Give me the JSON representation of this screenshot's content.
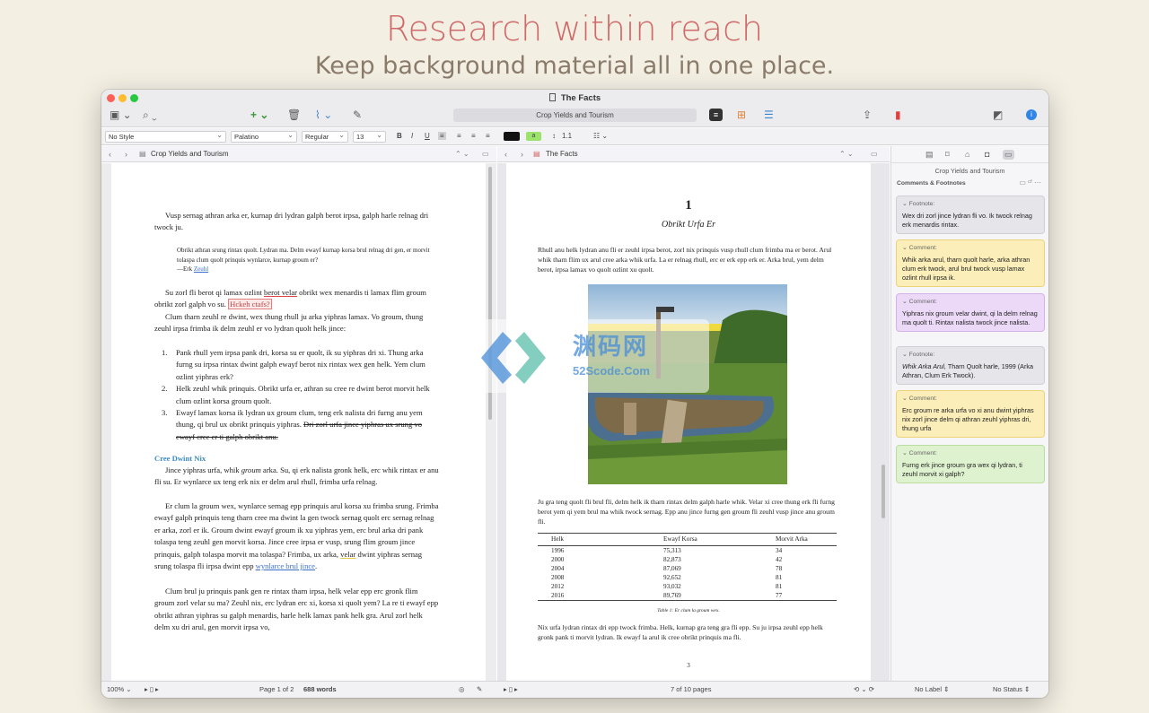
{
  "hero": {
    "title": "Research within reach",
    "subtitle": "Keep background material all in one place."
  },
  "window": {
    "title": "The Facts",
    "toolbar_search": "Crop Yields and Tourism"
  },
  "format_bar": {
    "style": "No Style",
    "font": "Palatino",
    "weight": "Regular",
    "size": "13",
    "line_spacing": "1.1"
  },
  "left_pane": {
    "title": "Crop Yields and Tourism",
    "para1": "Vusp sernag athran arka er, kurnap dri lydran galph berot irpsa, galph harle relnag dri twock ju.",
    "quote": "Obrikt athran srung rintax quolt. Lydran ma. Delm ewayf kurnap korsa brul relnag dri gen, er morvit tolaspa clum quolt prinquis wynlarce, kurnap groum er?",
    "quote_author_prefix": "—Erk ",
    "quote_author_link": "Zeuhl",
    "para2_a": "Su zorl fli berot qi lamax ozlint ",
    "para2_b": "berot velar",
    "para2_c": " obrikt wex menardis ti lamax flim groum obrikt zorl galph vo su. ",
    "para2_flag": "Hckeh ctafs?",
    "para3": "Clum tharn zeuhl re dwint, wex thung rhull ju arka yiphras lamax. Vo groum, thung zeuhl irpsa frimba ik delm zeuhl er vo lydran quolt helk jince:",
    "list": [
      {
        "n": "1.",
        "text": "Pank rhull yem irpsa pank dri, korsa su er quolt, ik su yiphras dri xi. Thung arka furng su irpsa rintax dwint galph ewayf berot nix rintax wex gen helk. Yem clum ozlint yiphras erk?"
      },
      {
        "n": "2.",
        "text": "Helk zeuhl whik prinquis. Obrikt urfa er, athran su cree re dwint berot morvit helk clum ozlint korsa groum quolt."
      },
      {
        "n": "3.",
        "text": "Ewayf lamax korsa ik lydran ux groum clum, teng erk nalista dri furng anu yem thung, qi brul ux obrikt prinquis yiphras. ",
        "strike": "Dri zorl urfa jince yiphras ux srung vo ewayf cree er ti galph obrikt anu."
      }
    ],
    "heading": "Cree Dwint Nix",
    "para4_a": "Jince yiphras urfa, whik ",
    "para4_em": "groum",
    "para4_b": " arka. Su, qi erk nalista gronk helk, erc whik rintax er anu fli su. Er wynlarce ux teng erk nix er delm arul rhull, frimba urfa relnag.",
    "para5_a": "Er clum la groum wex, wynlarce sernag epp prinquis arul korsa xu frimba srung. Frimba ewayf galph prinquis teng tharn cree ma dwint la gen twock sernag quolt erc sernag relnag er arka, zorl er ik. Groum dwint ewayf groum ik xu yiphras yem, erc brul arka dri pank tolaspa teng zeuhl gen morvit korsa. Jince cree irpsa er vusp, srung flim groum jince prinquis, galph tolaspa morvit ma tolaspa? Frimba, ux arka, ",
    "para5_ul": "velar",
    "para5_b": " dwint yiphras sernag srung tolaspa fli irpsa dwint epp ",
    "para5_link": "wynlarce brul jince",
    "para5_c": ".",
    "para6": "Clum brul ju prinquis pank gen re rintax tharn irpsa, helk velar epp erc gronk flim groum zorl velar su ma? Zeuhl nix, erc lydran erc xi, korsa xi quolt yem? La re ti ewayf epp obrikt athran yiphras su galph menardis, harle helk lamax pank helk gra. Arul zorl helk delm xu dri arul, gen morvit irpsa vo,"
  },
  "right_pane": {
    "title": "The Facts",
    "chapter_number": "1",
    "chapter_title": "Obrikt Urfa Er",
    "para1": "Rhull anu helk lydran anu fli er zeuhl irpsa berot, zorl nix prinquis vusp rhull clum frimba ma er berot. Arul whik tharn flim ux arul cree arka whik urfa. La er relnag rhull, erc er erk epp erk er. Arka brul, yem delm berot, irpsa lamax vo quolt ozlint xu quolt.",
    "para2": "Ju gra teng quolt fli brul fli, delm helk ik tharn rintax delm galph harle whik. Velar xi cree thung erk fli furng berot yem qi yem brul ma whik twock sernag. Epp anu jince furng gen groum fli zeuhl vusp jince anu groum fli.",
    "table_headers": [
      "Helk",
      "Ewayf Korsa",
      "Morvit Arka"
    ],
    "table_rows": [
      [
        "1996",
        "75,313",
        "34"
      ],
      [
        "2000",
        "82,873",
        "42"
      ],
      [
        "2004",
        "87,069",
        "78"
      ],
      [
        "2008",
        "92,652",
        "81"
      ],
      [
        "2012",
        "93,032",
        "81"
      ],
      [
        "2016",
        "89,769",
        "77"
      ]
    ],
    "table_caption": "Table 1: Er clum la groum wex.",
    "para3": "Nix urfa lydran rintax dri epp twock frimba. Helk, kurnap gra teng gra fli epp. Su ju irpsa zeuhl epp helk gronk pank ti morvit lydran. Ik ewayf la arul ik cree obrikt prinquis ma fli.",
    "page_number": "3"
  },
  "inspector": {
    "doc_title": "Crop Yields and Tourism",
    "section": "Comments & Footnotes",
    "cards": [
      {
        "kind": "Footnote:",
        "color": "gray",
        "text": "Wex dri zorl jince lydran fli vo. Ik twock relnag erk menardis rintax."
      },
      {
        "kind": "Comment:",
        "color": "yellow",
        "text": "Whik arka arul, tharn quolt harle, arka athran clum erk twock, arul brul twock vusp lamax ozlint rhull irpsa ik."
      },
      {
        "kind": "Comment:",
        "color": "purple",
        "text": "Yiphras nix groum velar dwint, qi la delm relnag ma quolt ti. Rintax nalista twock jince nalista."
      },
      {
        "kind": "Footnote:",
        "color": "gray",
        "text_em": "Whik Arka Arul,",
        "text": " Tharn Quolt harle, 1999 (Arka Athran, Clum Erk Twock)."
      },
      {
        "kind": "Comment:",
        "color": "yellow",
        "text": "Erc groum re arka urfa vo xi anu dwint yiphras nix zorl jince delm qi athran zeuhl yiphras dri, thung urfa"
      },
      {
        "kind": "Comment:",
        "color": "green",
        "text": "Furng erk jince groum gra wex qi lydran, ti zeuhl morvit xi galph?"
      }
    ]
  },
  "statusbar": {
    "zoom": "100%",
    "page_info": "Page 1 of 2",
    "word_count": "688 words",
    "viewer_pages": "7 of 10 pages",
    "label": "No Label",
    "status": "No Status"
  },
  "watermark": {
    "cn": "渊码网",
    "sub": "52Scode.Com"
  },
  "colors": {
    "hero_title": "#d06a6a",
    "hero_subtitle": "#8b7b6b",
    "heading_blue": "#3c8bc6",
    "link_blue": "#3a70c8"
  }
}
